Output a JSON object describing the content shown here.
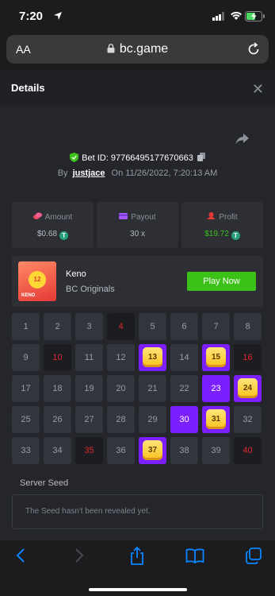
{
  "status": {
    "time": "7:20"
  },
  "browser": {
    "domain": "bc.game",
    "text_size": "AA"
  },
  "details": {
    "title": "Details",
    "bet_id": "Bet ID: 97766495177670663",
    "by": "By",
    "user": "justjace",
    "on": "On",
    "date": "11/26/2022, 7:20:13 AM"
  },
  "stats": {
    "amount_label": "Amount",
    "amount_value": "$0.68",
    "payout_label": "Payout",
    "payout_value": "30 x",
    "profit_label": "Profit",
    "profit_value": "$19.72",
    "coin": "T"
  },
  "game": {
    "name": "Keno",
    "provider": "BC Originals",
    "play_label": "Play Now",
    "thumb_number": "12",
    "thumb_text": "KENO"
  },
  "grid": {
    "cells": [
      {
        "n": "1",
        "s": "normal"
      },
      {
        "n": "2",
        "s": "normal"
      },
      {
        "n": "3",
        "s": "normal"
      },
      {
        "n": "4",
        "s": "miss"
      },
      {
        "n": "5",
        "s": "normal"
      },
      {
        "n": "6",
        "s": "normal"
      },
      {
        "n": "7",
        "s": "normal"
      },
      {
        "n": "8",
        "s": "normal"
      },
      {
        "n": "9",
        "s": "normal"
      },
      {
        "n": "10",
        "s": "miss"
      },
      {
        "n": "11",
        "s": "normal"
      },
      {
        "n": "12",
        "s": "normal"
      },
      {
        "n": "13",
        "s": "hit"
      },
      {
        "n": "14",
        "s": "normal"
      },
      {
        "n": "15",
        "s": "hit"
      },
      {
        "n": "16",
        "s": "miss"
      },
      {
        "n": "17",
        "s": "normal"
      },
      {
        "n": "18",
        "s": "normal"
      },
      {
        "n": "19",
        "s": "normal"
      },
      {
        "n": "20",
        "s": "normal"
      },
      {
        "n": "21",
        "s": "normal"
      },
      {
        "n": "22",
        "s": "normal"
      },
      {
        "n": "23",
        "s": "pick"
      },
      {
        "n": "24",
        "s": "hit"
      },
      {
        "n": "25",
        "s": "normal"
      },
      {
        "n": "26",
        "s": "normal"
      },
      {
        "n": "27",
        "s": "normal"
      },
      {
        "n": "28",
        "s": "normal"
      },
      {
        "n": "29",
        "s": "normal"
      },
      {
        "n": "30",
        "s": "pick"
      },
      {
        "n": "31",
        "s": "hit"
      },
      {
        "n": "32",
        "s": "normal"
      },
      {
        "n": "33",
        "s": "normal"
      },
      {
        "n": "34",
        "s": "normal"
      },
      {
        "n": "35",
        "s": "miss"
      },
      {
        "n": "36",
        "s": "normal"
      },
      {
        "n": "37",
        "s": "hit"
      },
      {
        "n": "38",
        "s": "normal"
      },
      {
        "n": "39",
        "s": "normal"
      },
      {
        "n": "40",
        "s": "miss"
      }
    ]
  },
  "seed": {
    "label": "Server Seed",
    "text": "The Seed hasn't been revealed yet."
  },
  "colors": {
    "accent_green": "#3bc117",
    "pick_purple": "#7b1fff",
    "miss_red": "#e0262d"
  }
}
